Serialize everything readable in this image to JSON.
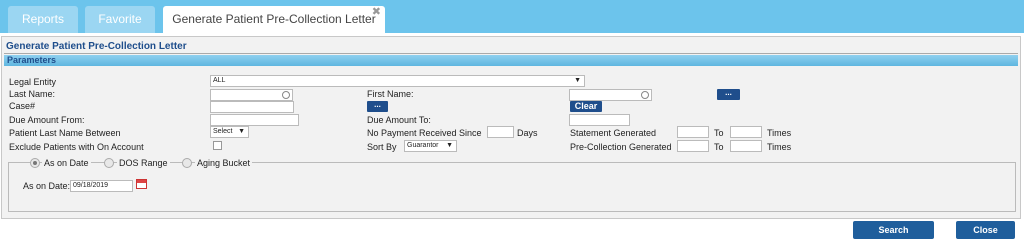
{
  "tabs": {
    "reports": "Reports",
    "favorite": "Favorite",
    "active": "Generate Patient Pre-Collection Letter",
    "close_glyph": "✖"
  },
  "page": {
    "title": "Generate Patient Pre-Collection Letter",
    "section": "Parameters"
  },
  "form": {
    "legal_entity_label": "Legal Entity",
    "legal_entity_value": "ALL",
    "last_name_label": "Last Name:",
    "first_name_label": "First Name:",
    "case_label": "Case#",
    "dots": "...",
    "clear": "Clear",
    "due_from_label": "Due Amount From:",
    "due_to_label": "Due Amount To:",
    "last_name_between_label": "Patient Last Name Between",
    "select_value": "Select",
    "no_payment_label": "No Payment Received Since",
    "days_label": "Days",
    "statement_generated_label": "Statement Generated",
    "to_label": "To",
    "times_label": "Times",
    "exclude_label": "Exclude Patients with On Account",
    "sort_by_label": "Sort By",
    "sort_by_value": "Guarantor",
    "pre_collection_label": "Pre-Collection Generated",
    "as_on_date_radio": "As on Date",
    "dos_range_radio": "DOS Range",
    "aging_bucket_radio": "Aging Bucket",
    "as_on_date_label": "As on Date:",
    "as_on_date_value": "09/18/2019",
    "dropdown_arrow": "▼"
  },
  "footer": {
    "search": "Search",
    "close": "Close"
  },
  "colors": {
    "accent": "#1f4e8c",
    "tabbar": "#6cc4ec"
  },
  "icons": [
    "close-icon",
    "calendar-icon",
    "chevron-down-icon"
  ]
}
